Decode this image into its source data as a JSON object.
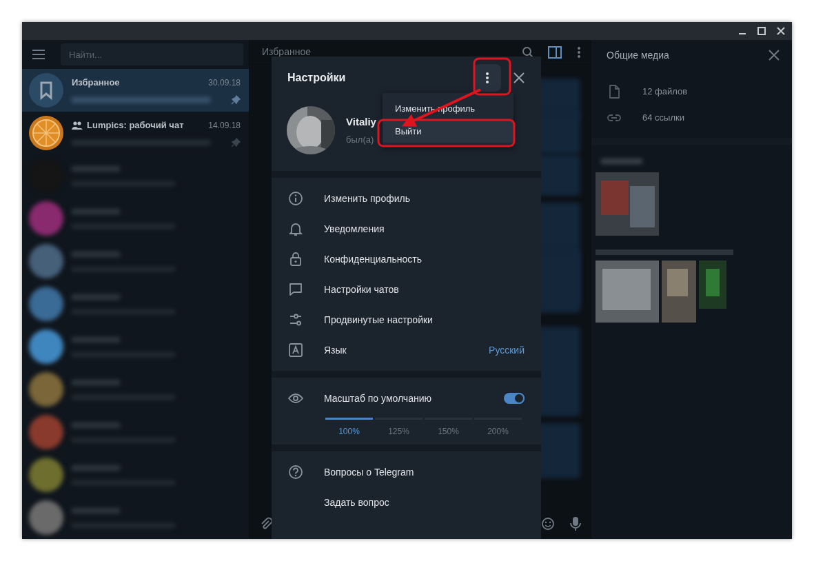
{
  "sidebar": {
    "search": {
      "placeholder": "Найти..."
    },
    "chats": [
      {
        "kind": "saved",
        "name": "Избранное",
        "date": "30.09.18",
        "selected": true,
        "pinned": true
      },
      {
        "kind": "group",
        "name": "Lumpics: рабочий чат",
        "date": "14.09.18",
        "selected": false,
        "pinned": true
      },
      {
        "kind": "blurred",
        "color": "#151515"
      },
      {
        "kind": "blurred",
        "color": "#8a2a6e"
      },
      {
        "kind": "blurred",
        "color": "#46607a"
      },
      {
        "kind": "blurred",
        "color": "#3a6a96"
      },
      {
        "kind": "blurred",
        "color": "#3f86bf"
      },
      {
        "kind": "blurred",
        "color": "#7a6638"
      },
      {
        "kind": "blurred",
        "color": "#8a3a2c"
      },
      {
        "kind": "blurred",
        "color": "#6e6e2e"
      },
      {
        "kind": "blurred",
        "color": "#6a6a6a"
      }
    ]
  },
  "chat": {
    "title": "Избранное"
  },
  "media": {
    "title": "Общие медиа",
    "items": [
      {
        "kind": "file",
        "label": "12 файлов"
      },
      {
        "kind": "link",
        "label": "64 ссылки"
      }
    ]
  },
  "settings": {
    "title": "Настройки",
    "menu": [
      {
        "label": "Изменить профиль",
        "highlighted": false
      },
      {
        "label": "Выйти",
        "highlighted": true
      }
    ],
    "profile": {
      "name": "Vitaliy",
      "status": "был(а)"
    },
    "items": [
      {
        "kind": "info",
        "label": "Изменить профиль"
      },
      {
        "kind": "bell",
        "label": "Уведомления"
      },
      {
        "kind": "lock",
        "label": "Конфиденциальность"
      },
      {
        "kind": "chat",
        "label": "Настройки чатов"
      },
      {
        "kind": "sliders",
        "label": "Продвинутые настройки"
      },
      {
        "kind": "language",
        "label": "Язык",
        "value": "Русский"
      }
    ],
    "scale": {
      "label": "Масштаб по умолчанию",
      "on": true,
      "options": [
        {
          "label": "100%",
          "selected": true
        },
        {
          "label": "125%",
          "selected": false
        },
        {
          "label": "150%",
          "selected": false
        },
        {
          "label": "200%",
          "selected": false
        }
      ]
    },
    "help": [
      {
        "kind": "question",
        "label": "Вопросы о Telegram"
      },
      {
        "kind": "plain",
        "label": "Задать вопрос"
      }
    ]
  }
}
